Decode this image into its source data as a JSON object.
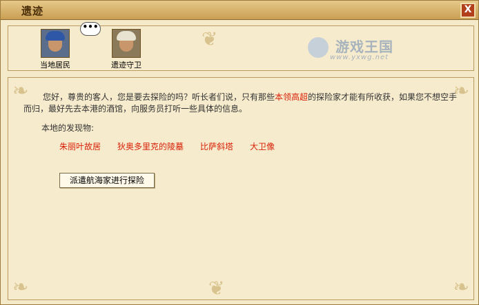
{
  "window": {
    "title": "遗迹",
    "close_label": "X"
  },
  "npcs": [
    {
      "name": "当地居民",
      "icon": "local-resident-portrait"
    },
    {
      "name": "遗迹守卫",
      "icon": "ruin-guard-portrait"
    }
  ],
  "speech_bubble": "•••",
  "logo": {
    "text": "游戏王国",
    "url": "www.yxwg.net"
  },
  "message": {
    "part1": "您好，尊贵的客人，您是要去探险的吗？听长者们说，只有那些",
    "highlight": "本领高超",
    "part2": "的探险家才能有所收获，如果您不想空手而归，最好先去本港的酒馆，向服务员打听一些具体的信息。"
  },
  "discoveries": {
    "label": "本地的发现物:",
    "items": [
      "朱丽叶故居",
      "狄奥多里克的陵墓",
      "比萨斜塔",
      "大卫像"
    ]
  },
  "action_button": "派遣航海家进行探险",
  "colors": {
    "highlight": "#d81e06",
    "title_bar": "#c99e52"
  }
}
